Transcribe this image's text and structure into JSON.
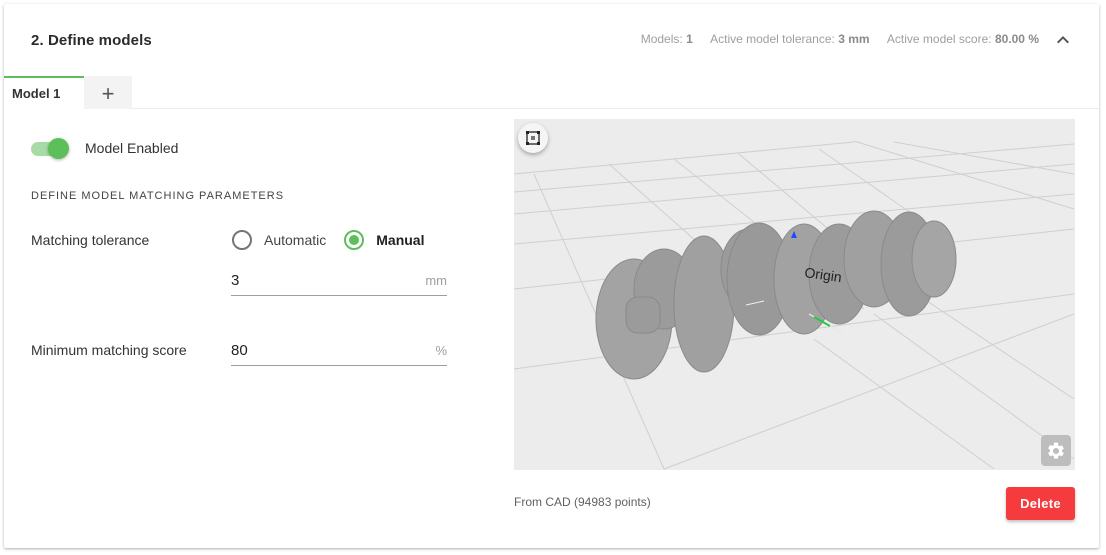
{
  "header": {
    "title": "2. Define models",
    "summary": {
      "models_label": "Models:",
      "models_value": "1",
      "tolerance_label": "Active model tolerance:",
      "tolerance_value": "3 mm",
      "score_label": "Active model score:",
      "score_value": "80.00 %"
    },
    "collapse_icon": "chevron-up-icon"
  },
  "tabs": [
    {
      "label": "Model 1",
      "active": true
    },
    {
      "label": "+",
      "icon": "plus-icon"
    }
  ],
  "model": {
    "enabled_label": "Model Enabled",
    "enabled": true,
    "section_title": "DEFINE MODEL MATCHING PARAMETERS",
    "tolerance": {
      "label": "Matching tolerance",
      "options": [
        {
          "label": "Automatic",
          "checked": false
        },
        {
          "label": "Manual",
          "checked": true
        }
      ],
      "value": "3",
      "unit": "mm"
    },
    "score": {
      "label": "Minimum matching score",
      "value": "80",
      "unit": "%"
    }
  },
  "viewer": {
    "fit_icon": "fit-to-view-icon",
    "settings_icon": "gear-icon",
    "origin_label": "Origin",
    "source_text": "From CAD (94983 points)"
  },
  "actions": {
    "delete_label": "Delete"
  },
  "colors": {
    "accent": "#5cbf5a",
    "danger": "#f63b3e"
  }
}
